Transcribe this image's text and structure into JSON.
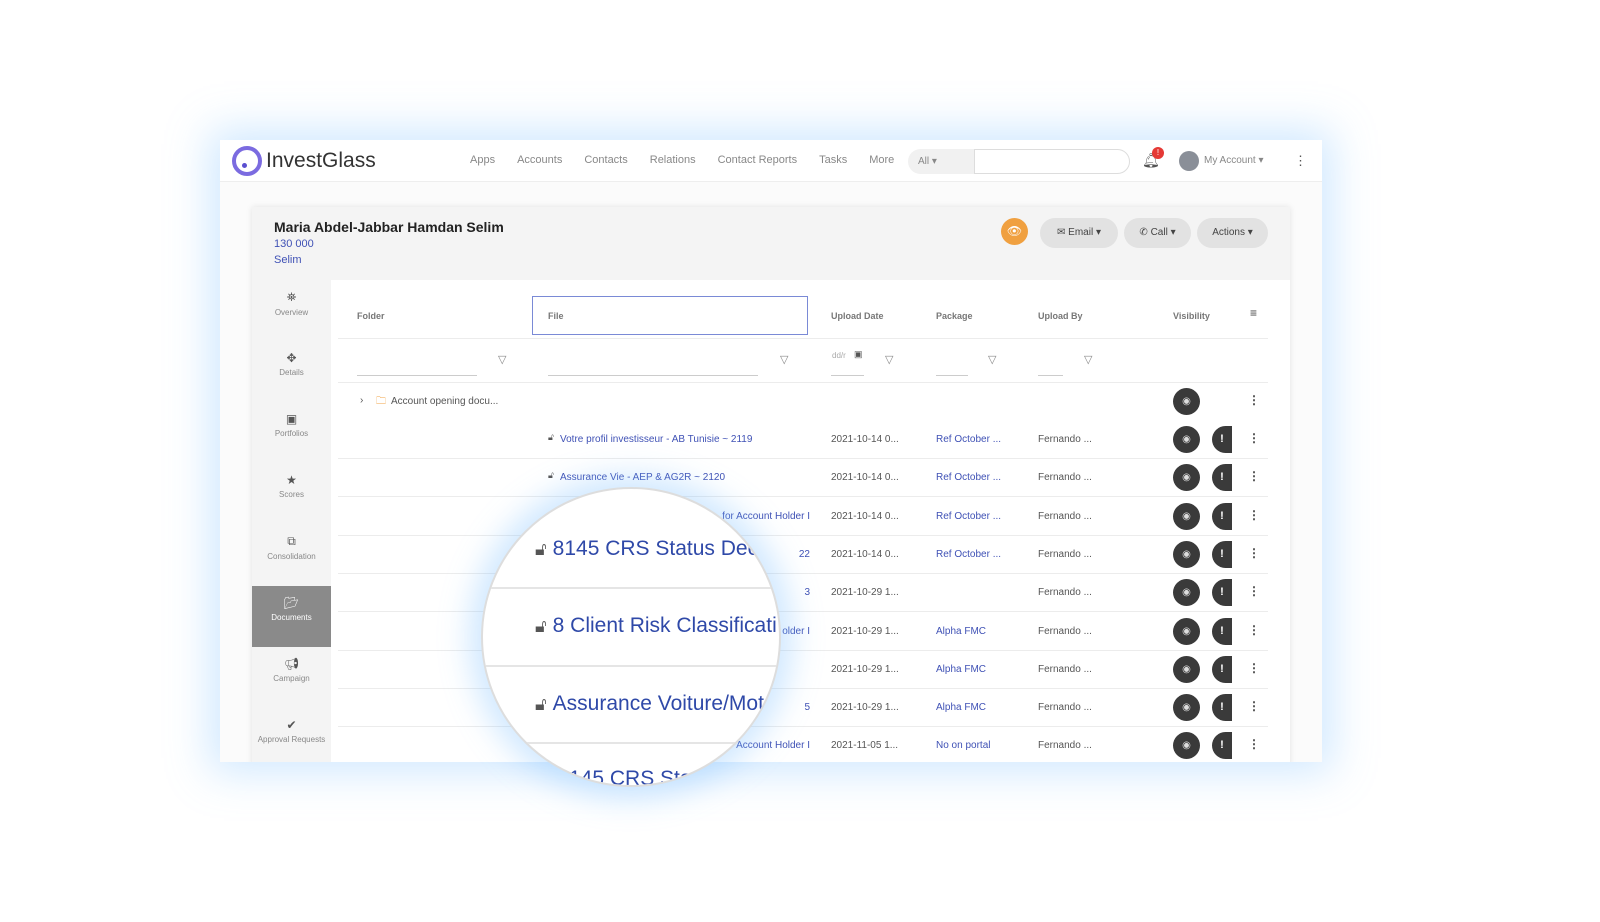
{
  "nav": {
    "brand": "InvestGlass",
    "menu": [
      "Apps",
      "Accounts",
      "Contacts",
      "Relations",
      "Contact Reports",
      "Tasks",
      "More"
    ],
    "search_scope": "All ▾",
    "search_value": "",
    "notification_count": "!",
    "account": "My Account ▾"
  },
  "contact": {
    "name": "Maria Abdel-Jabbar Hamdan Selim",
    "value": "130 000",
    "short_name": "Selim"
  },
  "actions": {
    "email": "Email ▾",
    "call": "Call ▾",
    "actions": "Actions ▾",
    "accent": "#f0a040"
  },
  "sidebar": [
    {
      "label": "Overview",
      "icon": "binoculars-icon"
    },
    {
      "label": "Details",
      "icon": "crosshair-icon"
    },
    {
      "label": "Portfolios",
      "icon": "briefcase-icon"
    },
    {
      "label": "Scores",
      "icon": "star-icon"
    },
    {
      "label": "Consolidation",
      "icon": "clone-icon"
    },
    {
      "label": "Documents",
      "icon": "folder-open-icon",
      "active": true
    },
    {
      "label": "Campaign",
      "icon": "bullhorn-icon"
    },
    {
      "label": "Approval Requests",
      "icon": "check-circle-icon"
    }
  ],
  "table": {
    "headers": [
      "Folder",
      "File",
      "Upload Date",
      "Package",
      "Upload By",
      "Visibility"
    ],
    "date_placeholder": "dd/r",
    "folder_row": {
      "label": "Account opening docu..."
    },
    "rows": [
      {
        "file": "Votre profil investisseur - AB Tunisie ~ 2119",
        "date": "2021-10-14 0...",
        "package": "Ref October ...",
        "by": "Fernando ..."
      },
      {
        "file": "Assurance Vie - AEP & AG2R ~ 2120",
        "date": "2021-10-14 0...",
        "package": "Ref October ...",
        "by": "Fernando ..."
      },
      {
        "file": "for Account Holder I",
        "date": "2021-10-14 0...",
        "package": "Ref October ...",
        "by": "Fernando ..."
      },
      {
        "file": "22",
        "date": "2021-10-14 0...",
        "package": "Ref October ...",
        "by": "Fernando ..."
      },
      {
        "file": "3",
        "date": "2021-10-29 1...",
        "package": "",
        "by": "Fernando ..."
      },
      {
        "file": "older I",
        "date": "2021-10-29 1...",
        "package": "Alpha FMC",
        "by": "Fernando ..."
      },
      {
        "file": "",
        "date": "2021-10-29 1...",
        "package": "Alpha FMC",
        "by": "Fernando ..."
      },
      {
        "file": "5",
        "date": "2021-10-29 1...",
        "package": "Alpha FMC",
        "by": "Fernando ..."
      },
      {
        "file": "Account Holder I",
        "date": "2021-11-05 1...",
        "package": "No on portal",
        "by": "Fernando ..."
      }
    ]
  },
  "magnifier": [
    "8145 CRS Status Dec",
    "8 Client Risk Classificati",
    "Assurance Voiture/Mot",
    "145 CRS Sta"
  ]
}
